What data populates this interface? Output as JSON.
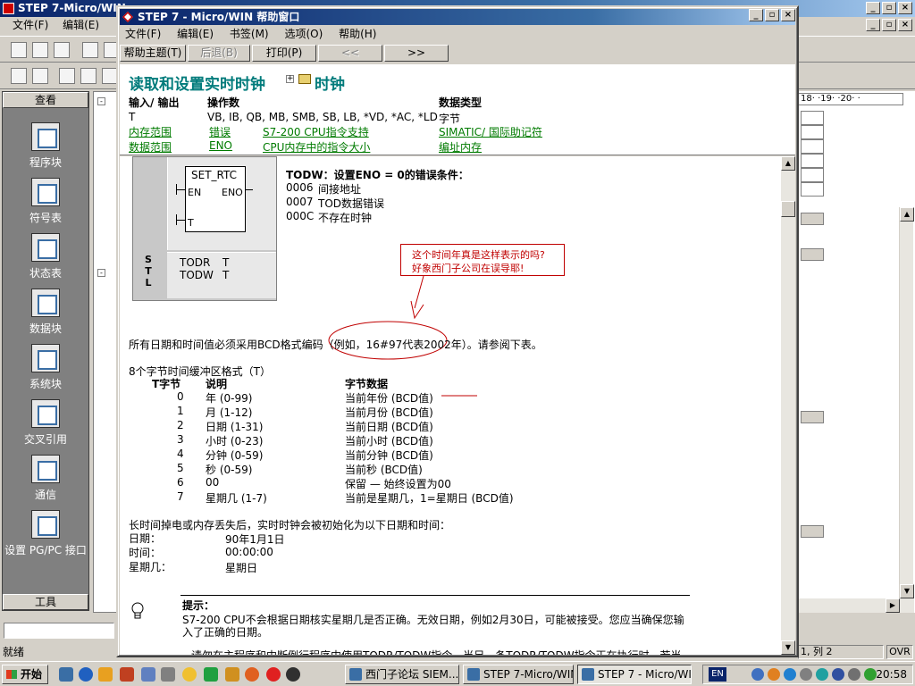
{
  "main_window": {
    "title": "STEP 7-Micro/WIN -",
    "menu": [
      "文件(F)",
      "编辑(E)"
    ],
    "caption": {
      "min": "_",
      "max": "▫",
      "close": "×"
    }
  },
  "nav": {
    "header": "查看",
    "footer": "工具",
    "items": [
      "程序块",
      "符号表",
      "状态表",
      "数据块",
      "系统块",
      "交叉引用",
      "通信",
      "设置 PG/PC 接口"
    ]
  },
  "ruler_text": "18· ·19· ·20· ·",
  "status": {
    "text": "就绪",
    "position": "1, 列 2",
    "mode": "OVR"
  },
  "taskbar": {
    "start": "开始",
    "tasks": [
      "西门子论坛 SIEM...",
      "STEP 7-Micro/WIN...",
      "STEP 7 - Micro/WI..."
    ],
    "lang": "EN",
    "clock": "20:58"
  },
  "help": {
    "title": "STEP 7 - Micro/WIN 帮助窗口",
    "menu": [
      "文件(F)",
      "编辑(E)",
      "书签(M)",
      "选项(O)",
      "帮助(H)"
    ],
    "buttons": {
      "topics": "帮助主题(T)",
      "back": "后退(B)",
      "print": "打印(P)",
      "prev": "<<",
      "next": ">>"
    },
    "topic_title": "读取和设置实时时钟",
    "breadcrumb": "时钟",
    "header": {
      "io_label": "输入/ 输出",
      "operand_label": "操作数",
      "type_label": "数据类型",
      "io_value": "T",
      "operand_value": "VB, IB, QB, MB, SMB, SB, LB, *VD, *AC, *LD",
      "type_value": "字节",
      "links": {
        "memory_range": "内存范围",
        "error": "错误",
        "s7_support": "S7-200 CPU指令支持",
        "simatic": "SIMATIC/ 国际助记符",
        "data_range": "数据范围",
        "eno": "ENO",
        "cpu_size": "CPU内存中的指令大小",
        "addressing": "编址内存"
      }
    },
    "ladder": {
      "block_name": "SET_RTC",
      "en": "EN",
      "eno": "ENO",
      "t": "T",
      "stl_label": "S T L",
      "stl_line1_op": "TODR",
      "stl_line1_arg": "T",
      "stl_line2_op": "TODW",
      "stl_line2_arg": "T"
    },
    "errors": {
      "title": "TODW：设置ENO = 0的错误条件：",
      "items": [
        {
          "code": "0006",
          "text": "间接地址"
        },
        {
          "code": "0007",
          "text": "TOD数据错误"
        },
        {
          "code": "000C",
          "text": "不存在时钟"
        }
      ]
    },
    "annotation": {
      "line1": "这个时间年真是这样表示的吗?",
      "line2": "好象西门子公司在误导耶!"
    },
    "bcd_text": "所有日期和时间值必须采用BCD格式编码（例如，16#97代表2002年）。请参阅下表。",
    "buffer_title": "8个字节时间缓冲区格式（T）",
    "table": {
      "headers": [
        "T字节",
        "说明",
        "字节数据"
      ],
      "rows": [
        [
          "0",
          "年 (0-99)",
          "当前年份 (BCD值)"
        ],
        [
          "1",
          "月 (1-12)",
          "当前月份 (BCD值)"
        ],
        [
          "2",
          "日期 (1-31)",
          "当前日期 (BCD值)"
        ],
        [
          "3",
          "小时 (0-23)",
          "当前小时 (BCD值)"
        ],
        [
          "4",
          "分钟 (0-59)",
          "当前分钟 (BCD值)"
        ],
        [
          "5",
          "秒 (0-59)",
          "当前秒 (BCD值)"
        ],
        [
          "6",
          "00",
          "保留 — 始终设置为00"
        ],
        [
          "7",
          "星期几 (1-7)",
          "当前是星期几，1=星期日 (BCD值)"
        ]
      ]
    },
    "power_loss": {
      "text": "长时间掉电或内存丢失后，实时时钟会被初始化为以下日期和时间：",
      "rows": [
        {
          "label": "日期：",
          "value": "90年1月1日"
        },
        {
          "label": "时间：",
          "value": "00:00:00"
        },
        {
          "label": "星期几：",
          "value": "星期日"
        }
      ]
    },
    "tip": {
      "title": "提示：",
      "line1": "S7-200 CPU不会根据日期核实星期几是否正确。无效日期，例如2月30日，可能被接受。您应当确保您输",
      "line2": "入了正确的日期。",
      "line3": "请勿在主程序和中断例行程序中使用TODR/TODW指令。当另一条TODR/TODW指令正在执行时，若当"
    }
  }
}
